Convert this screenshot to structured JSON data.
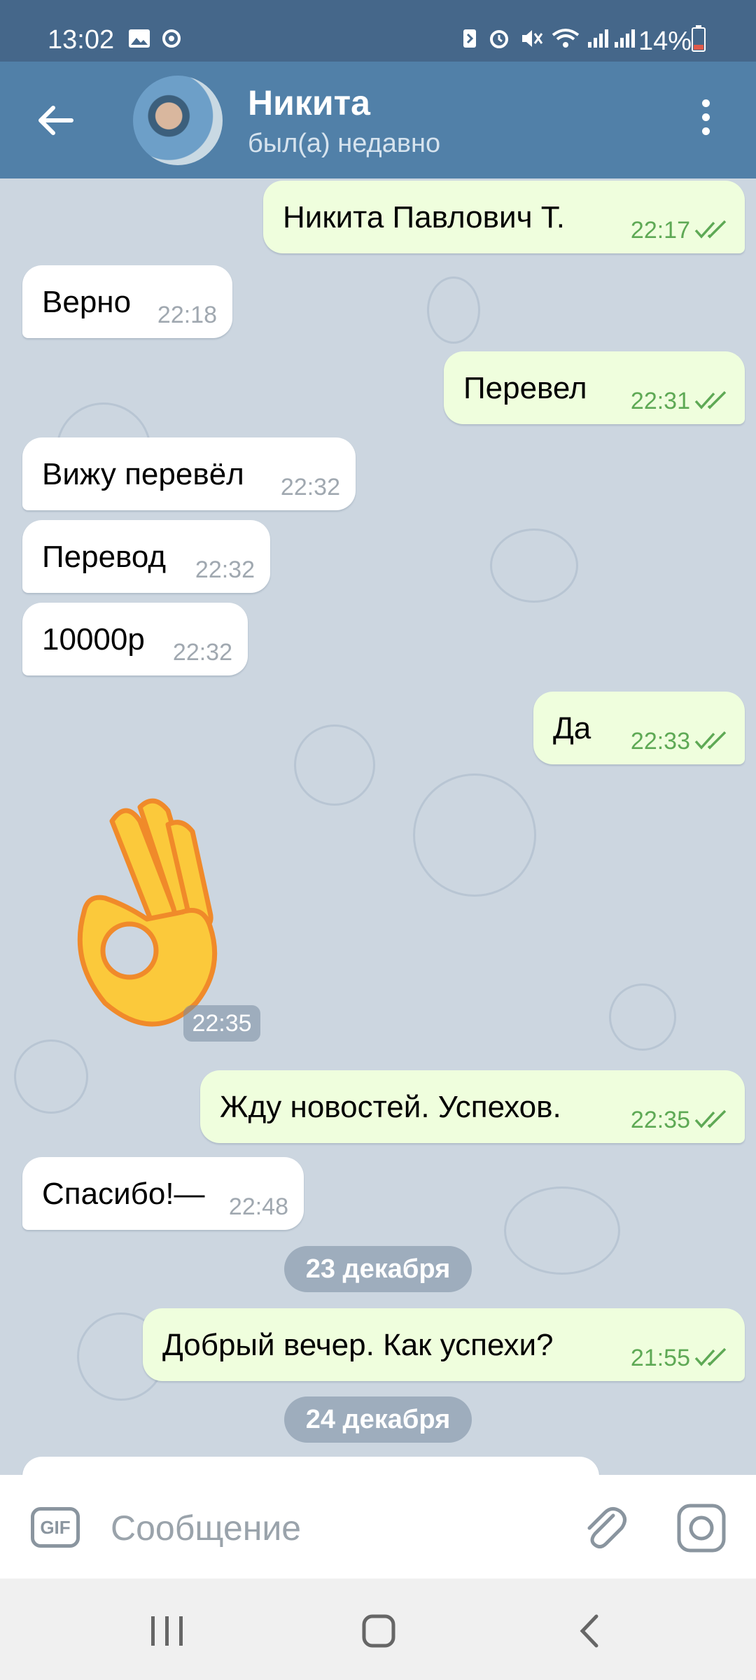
{
  "status_bar": {
    "time": "13:02",
    "battery": "14%",
    "icons": [
      "image-icon",
      "sync-icon",
      "battery-saver-icon",
      "alarm-icon",
      "mute-icon",
      "wifi-icon",
      "signal-icon",
      "signal-icon",
      "battery-icon"
    ]
  },
  "header": {
    "name": "Никита",
    "status": "был(а) недавно"
  },
  "messages": [
    {
      "dir": "out",
      "text": "Никита Павлович Т.",
      "time": "22:17"
    },
    {
      "dir": "in",
      "text": "Верно",
      "time": "22:18"
    },
    {
      "dir": "out",
      "text": "Перевел",
      "time": "22:31"
    },
    {
      "dir": "in",
      "text": "Вижу перевёл",
      "time": "22:32"
    },
    {
      "dir": "in",
      "text": "Перевод",
      "time": "22:32"
    },
    {
      "dir": "in",
      "text": "10000р",
      "time": "22:32"
    },
    {
      "dir": "out",
      "text": "Да",
      "time": "22:33"
    },
    {
      "dir": "in",
      "text": "👌",
      "time": "22:35",
      "type": "sticker"
    },
    {
      "dir": "out",
      "text": "Жду новостей. Успехов.",
      "time": "22:35"
    },
    {
      "dir": "in",
      "text": "Спасибо!—",
      "time": "22:48"
    },
    {
      "dir": "out",
      "text": "Добрый вечер. Как успехи?",
      "time": "21:55"
    }
  ],
  "dates": [
    "23 декабря",
    "24 декабря"
  ],
  "input": {
    "gif_label": "GIF",
    "placeholder": "Сообщение"
  },
  "colors": {
    "header": "#5180a8",
    "status_bar": "#45678a",
    "chat_background": "#ccd6e0",
    "outgoing_bubble": "#effedd",
    "incoming_bubble": "#ffffff",
    "read_ticks": "#5ea955"
  }
}
